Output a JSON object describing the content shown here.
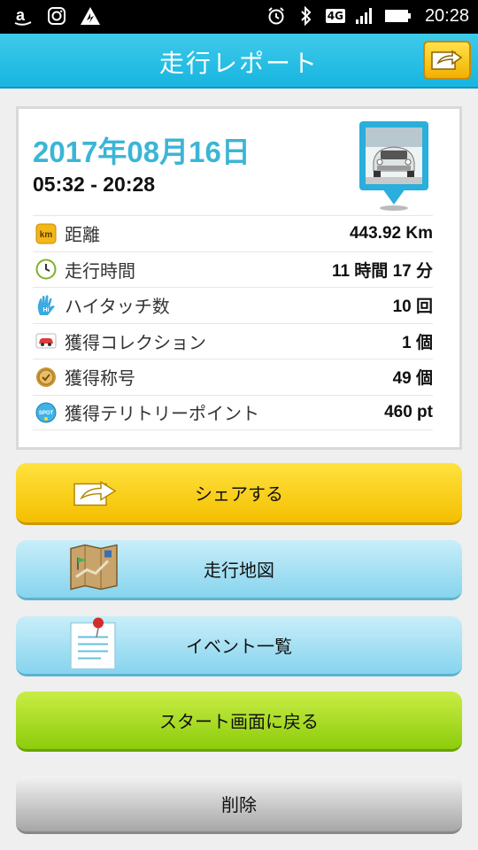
{
  "status_bar": {
    "network": "4G",
    "time": "20:28",
    "left_icons": [
      "amazon-icon",
      "instagram-icon",
      "triangle-app-icon"
    ],
    "right_icons": [
      "alarm-icon",
      "bluetooth-icon",
      "signal-icon",
      "battery-icon"
    ]
  },
  "header": {
    "title": "走行レポート",
    "share_icon": "share-icon"
  },
  "report": {
    "date": "2017年08月16日",
    "time_range": "05:32 - 20:28",
    "car_thumbnail": "car-pin-icon",
    "stats": [
      {
        "icon": "km-icon",
        "label": "距離",
        "value": "443.92 Km"
      },
      {
        "icon": "clock-icon",
        "label": "走行時間",
        "value": "11 時間 17 分"
      },
      {
        "icon": "hi-five-icon",
        "label": "ハイタッチ数",
        "value": "10 回"
      },
      {
        "icon": "car-collection-icon",
        "label": "獲得コレクション",
        "value": "1 個"
      },
      {
        "icon": "medal-icon",
        "label": "獲得称号",
        "value": "49 個"
      },
      {
        "icon": "spot-icon",
        "label": "獲得テリトリーポイント",
        "value": "460 pt"
      }
    ]
  },
  "buttons": {
    "share": "シェアする",
    "map": "走行地図",
    "events": "イベント一覧",
    "start": "スタート画面に戻る",
    "delete": "削除"
  },
  "colors": {
    "header": "#17b5e0",
    "date": "#3bb5d6",
    "share_button": "#f4bf00",
    "map_button": "#86d4ee",
    "start_button": "#8dcc0c",
    "delete_button": "#a6a6a6"
  }
}
